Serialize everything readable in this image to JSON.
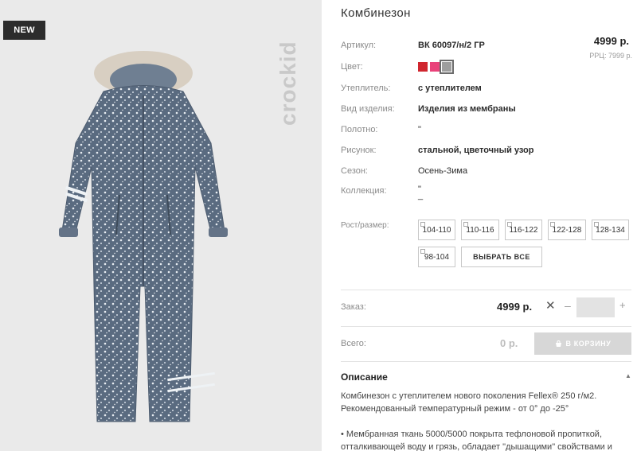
{
  "badge": "NEW",
  "brand_mark": "crockid",
  "product": {
    "title": "Комбинезон",
    "price": "4999 р.",
    "rrp": "РРЦ: 7999 р."
  },
  "attributes": [
    {
      "label": "Артикул:",
      "value": "ВК 60097/н/2 ГР"
    },
    {
      "label": "Цвет:",
      "value": ""
    },
    {
      "label": "Утеплитель:",
      "value": "с утеплителем"
    },
    {
      "label": "Вид изделия:",
      "value": "Изделия из мембраны"
    },
    {
      "label": "Полотно:",
      "value": "\""
    },
    {
      "label": "Рисунок:",
      "value": "стальной, цветочный узор"
    },
    {
      "label": "Сезон:",
      "value": "Осень-Зима"
    },
    {
      "label": "Коллекция:",
      "value": "\"\n_"
    }
  ],
  "colors": [
    {
      "name": "red",
      "hex": "#d0262f"
    },
    {
      "name": "pink",
      "hex": "#e9427a"
    },
    {
      "name": "grey",
      "hex": "#9e9e9e",
      "selected": true
    }
  ],
  "sizes_label": "Рост/размер:",
  "sizes": [
    "104-110",
    "110-116",
    "116-122",
    "122-128",
    "128-134",
    "98-104"
  ],
  "select_all": "ВЫБРАТЬ ВСЕ",
  "order": {
    "label": "Заказ:",
    "price": "4999 р.",
    "quantity": ""
  },
  "total": {
    "label": "Всего:",
    "value": "0 р.",
    "cart_button": "В КОРЗИНУ"
  },
  "description": {
    "title": "Описание",
    "paragraphs": [
      "Комбинезон с утеплителем нового поколения Fellex® 250 г/м2. Рекомендованный температурный режим - от 0° до -25°",
      "• Мембранная ткань 5000/5000 покрыта тефлоновой пропиткой, отталкивающей воду и грязь, обладает \"дышащими\" свойствами и"
    ]
  },
  "icons": {
    "remove": "close-icon",
    "decrease": "minus-icon",
    "increase": "plus-icon",
    "cart": "cart-icon",
    "collapse": "chevron-up-icon"
  }
}
